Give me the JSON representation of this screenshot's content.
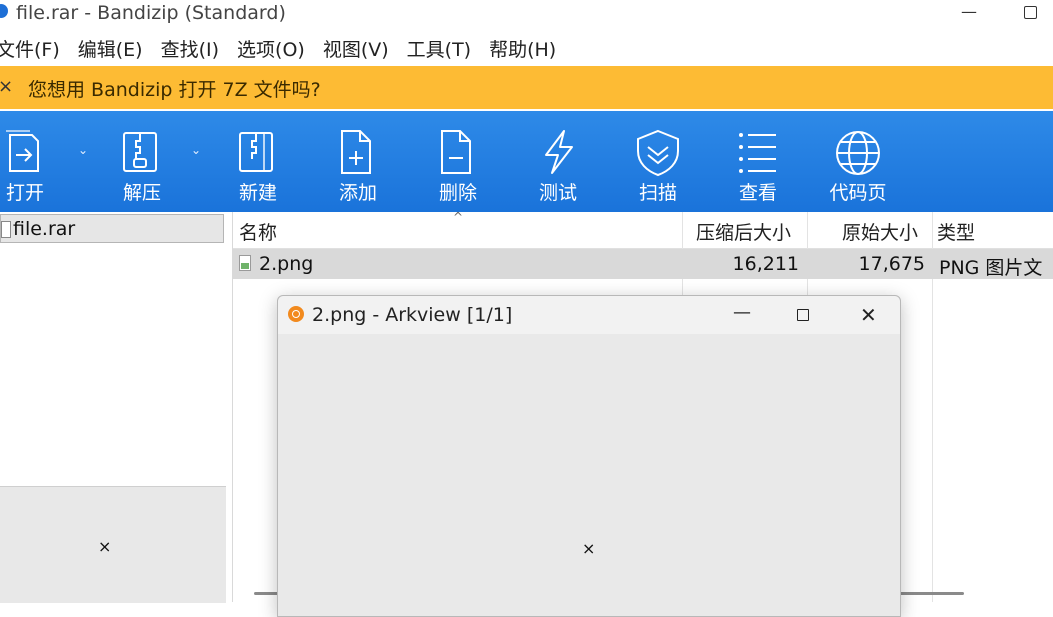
{
  "window": {
    "title": "file.rar - Bandizip (Standard)",
    "minimize_glyph": "—"
  },
  "menu": [
    "文件(F)",
    "编辑(E)",
    "查找(I)",
    "选项(O)",
    "视图(V)",
    "工具(T)",
    "帮助(H)"
  ],
  "notification": {
    "close_glyph": "×",
    "text": "您想用 Bandizip 打开 7Z 文件吗?"
  },
  "toolbar": [
    {
      "label": "打开",
      "icon": "open-icon"
    },
    {
      "label": "解压",
      "icon": "extract-icon"
    },
    {
      "label": "新建",
      "icon": "new-archive-icon"
    },
    {
      "label": "添加",
      "icon": "add-file-icon"
    },
    {
      "label": "删除",
      "icon": "delete-file-icon"
    },
    {
      "label": "测试",
      "icon": "test-icon"
    },
    {
      "label": "扫描",
      "icon": "scan-shield-icon"
    },
    {
      "label": "查看",
      "icon": "view-list-icon"
    },
    {
      "label": "代码页",
      "icon": "codepage-globe-icon"
    }
  ],
  "toolbar_dropdown_glyph": "⌄",
  "tree": {
    "label": "file.rar"
  },
  "left_preview_close": "×",
  "list": {
    "sort_caret": "^",
    "columns": [
      "名称",
      "压缩后大小",
      "原始大小",
      "类型"
    ],
    "rows": [
      {
        "name": "2.png",
        "packed": "16,211",
        "original": "17,675",
        "type": "PNG 图片文"
      }
    ]
  },
  "dialog": {
    "title": "2.png - Arkview [1/1]",
    "minimize_glyph": "—",
    "close_glyph": "✕",
    "content_close": "×"
  },
  "colors": {
    "toolbar_blue": "#1a73da",
    "notification_yellow": "#fdbb34",
    "selected_row": "#d9d9d9"
  }
}
